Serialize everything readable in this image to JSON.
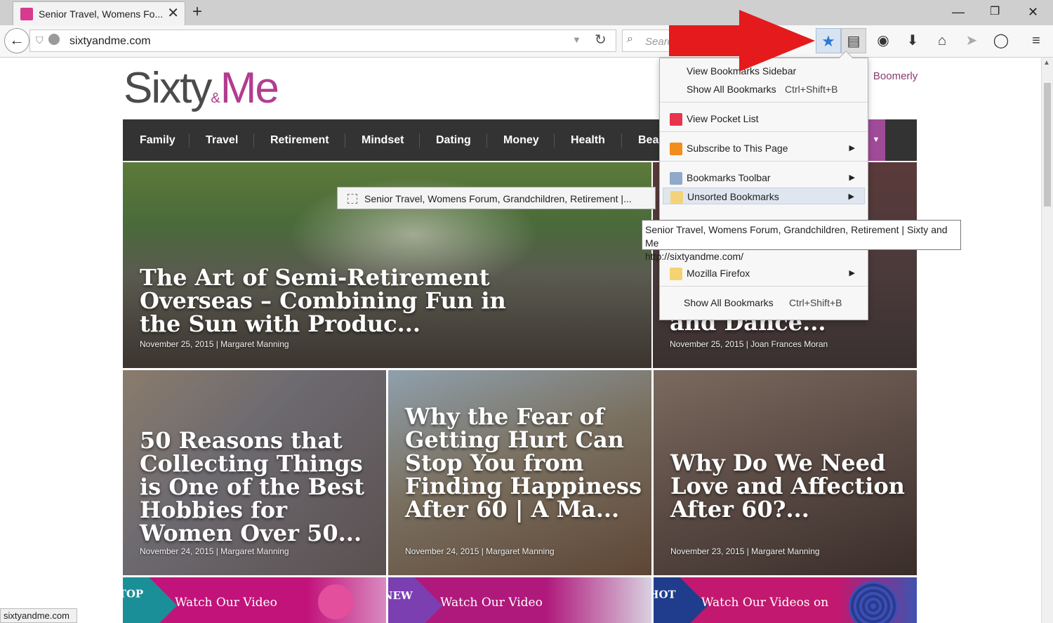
{
  "browser": {
    "tab_title": "Senior Travel, Womens Fo...",
    "url": "sixtyandme.com",
    "search_placeholder": "Search",
    "colors": {
      "accent_star": "#2a78d8",
      "arrow": "#e41a1c"
    }
  },
  "site": {
    "logo_left": "Sixty",
    "logo_amp": "&",
    "logo_right": "Me",
    "top_link_sep": "|",
    "top_link": "Boomerly",
    "nav": [
      "Family",
      "Travel",
      "Retirement",
      "Mindset",
      "Dating",
      "Money",
      "Health",
      "Bea"
    ],
    "nav_more": "▼",
    "brand_color": "#b23c8f"
  },
  "articles": [
    {
      "title": "The Art of Semi-Retirement Overseas – Combining Fun in the Sun with Produc...",
      "meta": "November 25, 2015 | Margaret Manning"
    },
    {
      "title": "and Dance...",
      "meta": "November 25, 2015 | Joan Frances Moran"
    },
    {
      "title": "50 Reasons that Collecting Things is One of the Best Hobbies for Women Over 50...",
      "meta": "November 24, 2015 | Margaret Manning"
    },
    {
      "title": "Why the Fear of Getting Hurt Can Stop You from Finding Happiness After 60 | A Ma...",
      "meta": "November 24, 2015 | Margaret Manning"
    },
    {
      "title": "Why Do We Need Love and Affection After 60?...",
      "meta": "November 23, 2015 | Margaret Manning"
    }
  ],
  "videos": [
    {
      "badge": "TOP",
      "label": "Watch Our Video"
    },
    {
      "badge": "NEW",
      "label": "Watch Our Video"
    },
    {
      "badge": "HOT",
      "label": "Watch Our Videos on"
    }
  ],
  "bookmarks_menu": {
    "view_sidebar": "View Bookmarks Sidebar",
    "show_all": "Show All Bookmarks",
    "show_all_shortcut": "Ctrl+Shift+B",
    "pocket": "View Pocket List",
    "subscribe": "Subscribe to This Page",
    "toolbar": "Bookmarks Toolbar",
    "unsorted": "Unsorted Bookmarks",
    "mozilla": "Mozilla Firefox",
    "show_all_bottom": "Show All Bookmarks",
    "show_all_bottom_shortcut": "Ctrl+Shift+B",
    "submenu_arrow": "▶"
  },
  "drag_tip": "Senior Travel, Womens Forum, Grandchildren, Retirement |...",
  "tooltip": {
    "title": "Senior Travel, Womens Forum, Grandchildren, Retirement | Sixty and Me",
    "url": "http://sixtyandme.com/"
  },
  "status_text": "sixtyandme.com"
}
